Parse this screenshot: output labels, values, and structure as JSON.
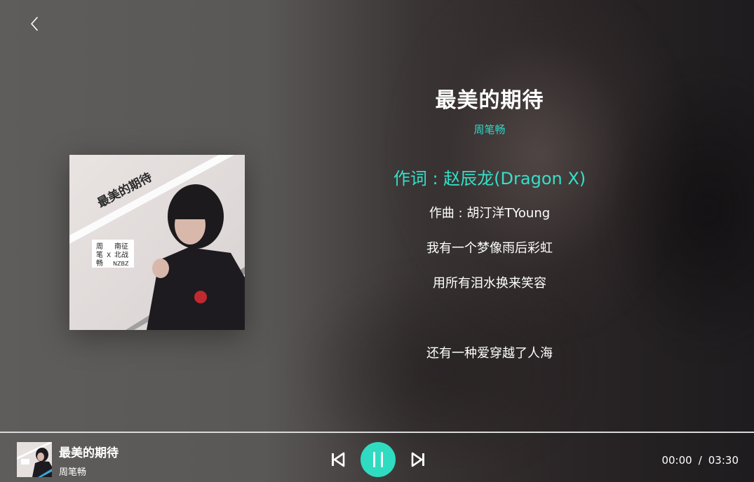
{
  "song": {
    "title": "最美的期待",
    "artist": "周笔畅"
  },
  "cover": {
    "text_title": "最美的期待",
    "text_left": [
      "周",
      "笔",
      "畅"
    ],
    "text_x": "X",
    "text_right": [
      "南征",
      "北战"
    ],
    "text_nzbz": "NZBZ"
  },
  "lyrics": [
    {
      "text": "作词 : 赵辰龙(Dragon X)",
      "active": true
    },
    {
      "text": "作曲 : 胡汀洋TYoung",
      "active": false
    },
    {
      "text": "我有一个梦像雨后彩虹",
      "active": false
    },
    {
      "text": "用所有泪水换来笑容",
      "active": false
    },
    {
      "text": "",
      "active": false
    },
    {
      "text": "还有一种爱穿越了人海",
      "active": false
    }
  ],
  "player": {
    "title": "最美的期待",
    "artist": "周笔畅",
    "current_time": "00:00",
    "separator": "/",
    "total_time": "03:30",
    "progress": 0
  },
  "icons": {
    "back": "chevron-left-icon",
    "prev": "skip-previous-icon",
    "play": "pause-icon",
    "next": "skip-next-icon"
  },
  "colors": {
    "accent": "#2fdcc1",
    "active_lyric": "#34e0c8",
    "text": "#ffffff"
  }
}
